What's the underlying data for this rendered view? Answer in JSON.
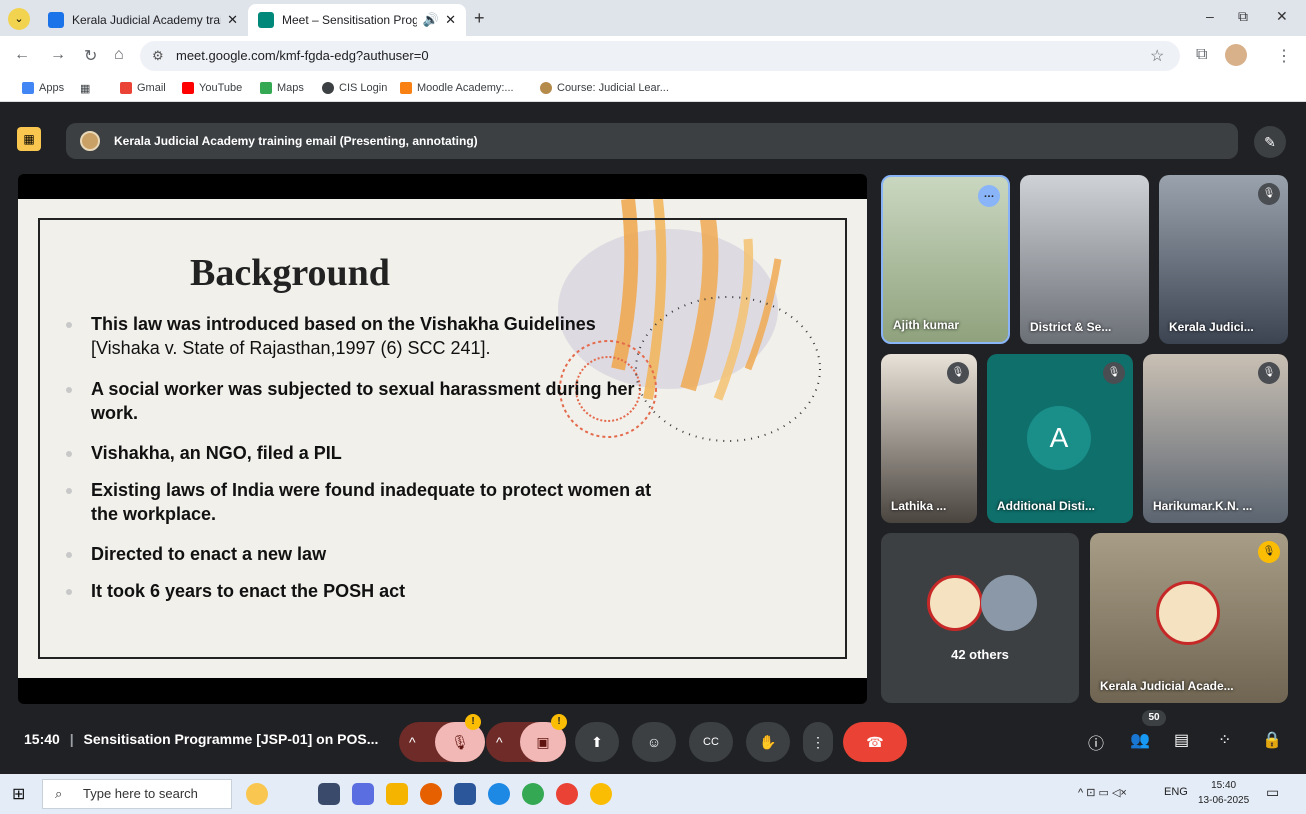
{
  "browser": {
    "tabs": [
      {
        "label": "Kerala Judicial Academy trainin",
        "favicon_color": "#1a73e8"
      },
      {
        "label": "Meet – Sensitisation Progra",
        "favicon_color": "#00897b"
      }
    ],
    "new_tab": "+",
    "window_controls": {
      "minimize": "–",
      "restore": "⧉",
      "close": "✕"
    },
    "url": "meet.google.com/kmf-fgda-edg?authuser=0",
    "bookmarks": [
      {
        "label": "Apps",
        "color": "#4285f4"
      },
      {
        "label": "Gmail",
        "color": "#ea4335"
      },
      {
        "label": "YouTube",
        "color": "#ff0000"
      },
      {
        "label": "Maps",
        "color": "#34a853"
      },
      {
        "label": "CIS Login",
        "color": "#3c4043"
      },
      {
        "label": "Moodle Academy:...",
        "color": "#f98012"
      },
      {
        "label": "Course: Judicial Lear...",
        "color": "#b58b4c"
      }
    ]
  },
  "meet": {
    "presentation_label": "Kerala Judicial Academy training email (Presenting, annotating)",
    "slide": {
      "title": "Background",
      "bullets": [
        {
          "bold": "This law was introduced based on the Vishakha Guidelines",
          "normal": "[Vishaka v. State of Rajasthan,1997 (6) SCC 241]."
        },
        {
          "bold": "A social worker was subjected to sexual harassment during her work.",
          "normal": ""
        },
        {
          "bold": "Vishakha, an NGO, filed a PIL",
          "normal": ""
        },
        {
          "bold": "Existing laws of India were found inadequate to protect women at the workplace.",
          "normal": ""
        },
        {
          "bold": "Directed to enact a new law",
          "normal": ""
        },
        {
          "bold": "It took 6 years to enact the POSH act",
          "normal": ""
        }
      ]
    },
    "participants": [
      {
        "name": "Ajith kumar"
      },
      {
        "name": "District & Se..."
      },
      {
        "name": "Kerala Judici..."
      },
      {
        "name": "Lathika ..."
      },
      {
        "name": "Additional Disti...",
        "initial": "A"
      },
      {
        "name": "Harikumar.K.N. ..."
      },
      {
        "name": "42 others"
      },
      {
        "name": "Kerala Judicial Acade..."
      }
    ],
    "meeting_time": "15:40",
    "meeting_title": "Sensitisation Programme [JSP-01] on POS...",
    "participant_count": "50",
    "colors": {
      "end_call": "#ea4335",
      "muted_ctrl": "#6f2b28",
      "muted_ctrl_light": "#f2b8b5",
      "ctrl_bg": "#3c4043",
      "accent_yellow": "#fbbc04"
    }
  },
  "taskbar": {
    "search_placeholder": "Type here to search",
    "lang": "ENG",
    "time": "15:40",
    "date": "13-06-2025"
  }
}
